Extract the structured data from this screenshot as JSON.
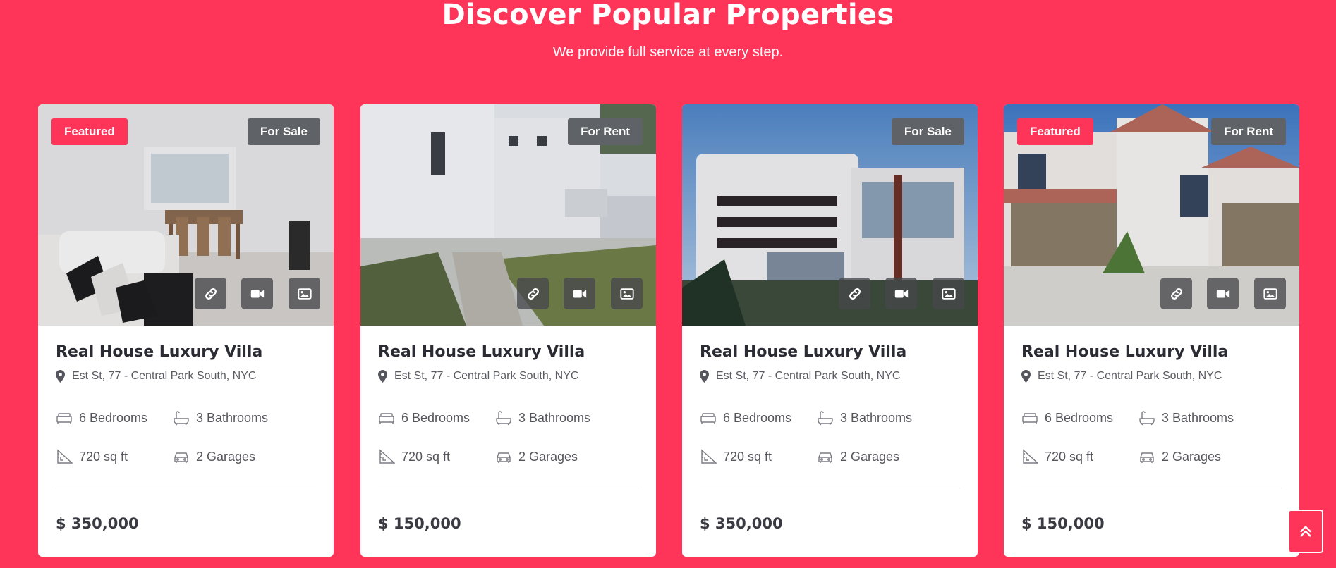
{
  "header": {
    "title": "Discover Popular Properties",
    "subtitle": "We provide full service at every step."
  },
  "colors": {
    "accent": "#ff3459",
    "status_badge": "#5f6266"
  },
  "icons": {
    "media": [
      "link-icon",
      "video-icon",
      "image-icon"
    ],
    "address": "map-pin-icon",
    "features": [
      "bed-icon",
      "bath-icon",
      "area-icon",
      "garage-icon"
    ],
    "scroll": "double-chevron-up-icon"
  },
  "properties": [
    {
      "featured": "Featured",
      "status": "For Sale",
      "title": "Real House Luxury Villa",
      "address": "Est St, 77 - Central Park South, NYC",
      "bedrooms": "6 Bedrooms",
      "bathrooms": "3 Bathrooms",
      "area": "720 sq ft",
      "garages": "2 Garages",
      "price": "$ 350,000"
    },
    {
      "featured": "",
      "status": "For Rent",
      "title": "Real House Luxury Villa",
      "address": "Est St, 77 - Central Park South, NYC",
      "bedrooms": "6 Bedrooms",
      "bathrooms": "3 Bathrooms",
      "area": "720 sq ft",
      "garages": "2 Garages",
      "price": "$ 150,000"
    },
    {
      "featured": "",
      "status": "For Sale",
      "title": "Real House Luxury Villa",
      "address": "Est St, 77 - Central Park South, NYC",
      "bedrooms": "6 Bedrooms",
      "bathrooms": "3 Bathrooms",
      "area": "720 sq ft",
      "garages": "2 Garages",
      "price": "$ 350,000"
    },
    {
      "featured": "Featured",
      "status": "For Rent",
      "title": "Real House Luxury Villa",
      "address": "Est St, 77 - Central Park South, NYC",
      "bedrooms": "6 Bedrooms",
      "bathrooms": "3 Bathrooms",
      "area": "720 sq ft",
      "garages": "2 Garages",
      "price": "$ 150,000"
    }
  ]
}
